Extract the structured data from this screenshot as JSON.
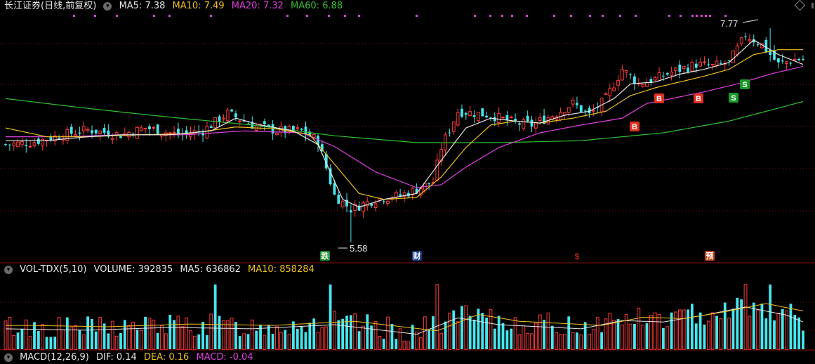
{
  "main_header": {
    "stock_label": "长江证券(日线,前复权)",
    "ma5": "MA5: 7.38",
    "ma10": "MA10: 7.49",
    "ma20": "MA20: 7.32",
    "ma60": "MA60: 6.88"
  },
  "volume_header": {
    "indicator": "VOL-TDX(5,10)",
    "volume": "VOLUME: 392835",
    "ma5": "MA5: 636862",
    "ma10": "MA10: 858284"
  },
  "macd_header": {
    "indicator": "MACD(12,26,9)",
    "dif": "DIF: 0.14",
    "dea": "DEA: 0.16",
    "macd": "MACD: -0.04"
  },
  "annotations": {
    "high_label": "7.77",
    "low_label": "5.58"
  },
  "colors": {
    "up": "#ff3a3a",
    "down": "#46e6ee",
    "ma5": "#e6e6e6",
    "ma10": "#f0c020",
    "ma20": "#e040e0",
    "ma60": "#30c030",
    "grid": "#7a1010"
  },
  "chart_data": {
    "type": "candlestick",
    "price_axis": [
      5.4,
      7.9
    ],
    "high": 7.77,
    "low": 5.58,
    "price_path": [
      [
        0,
        6.58
      ],
      [
        6,
        6.6
      ],
      [
        14,
        6.68
      ],
      [
        20,
        6.73
      ],
      [
        28,
        6.68
      ],
      [
        34,
        6.75
      ],
      [
        42,
        6.68
      ],
      [
        48,
        6.72
      ],
      [
        54,
        6.9
      ],
      [
        60,
        6.78
      ],
      [
        66,
        6.72
      ],
      [
        72,
        6.72
      ],
      [
        76,
        6.62
      ],
      [
        80,
        6.06
      ],
      [
        84,
        5.92
      ],
      [
        90,
        6.02
      ],
      [
        96,
        6.06
      ],
      [
        100,
        6.12
      ],
      [
        104,
        6.2
      ],
      [
        106,
        6.55
      ],
      [
        110,
        6.92
      ],
      [
        114,
        6.9
      ],
      [
        118,
        6.88
      ],
      [
        124,
        6.8
      ],
      [
        128,
        6.78
      ],
      [
        134,
        6.9
      ],
      [
        138,
        7.0
      ],
      [
        142,
        6.88
      ],
      [
        146,
        7.05
      ],
      [
        150,
        7.35
      ],
      [
        154,
        7.2
      ],
      [
        158,
        7.25
      ],
      [
        162,
        7.32
      ],
      [
        168,
        7.4
      ],
      [
        172,
        7.38
      ],
      [
        176,
        7.42
      ],
      [
        180,
        7.7
      ],
      [
        184,
        7.6
      ],
      [
        188,
        7.4
      ],
      [
        192,
        7.45
      ],
      [
        194,
        7.45
      ]
    ],
    "ma5_path": [
      [
        0,
        6.62
      ],
      [
        10,
        6.62
      ],
      [
        20,
        6.66
      ],
      [
        28,
        6.68
      ],
      [
        40,
        6.68
      ],
      [
        50,
        6.72
      ],
      [
        56,
        6.85
      ],
      [
        62,
        6.78
      ],
      [
        70,
        6.72
      ],
      [
        76,
        6.58
      ],
      [
        82,
        6.02
      ],
      [
        86,
        5.94
      ],
      [
        92,
        6.02
      ],
      [
        100,
        6.08
      ],
      [
        106,
        6.42
      ],
      [
        112,
        6.75
      ],
      [
        118,
        6.85
      ],
      [
        124,
        6.82
      ],
      [
        130,
        6.8
      ],
      [
        136,
        6.88
      ],
      [
        142,
        6.92
      ],
      [
        148,
        7.05
      ],
      [
        152,
        7.2
      ],
      [
        158,
        7.22
      ],
      [
        164,
        7.3
      ],
      [
        170,
        7.35
      ],
      [
        176,
        7.42
      ],
      [
        182,
        7.65
      ],
      [
        188,
        7.5
      ],
      [
        194,
        7.4
      ]
    ],
    "ma10_path": [
      [
        0,
        6.75
      ],
      [
        10,
        6.66
      ],
      [
        20,
        6.66
      ],
      [
        32,
        6.68
      ],
      [
        44,
        6.69
      ],
      [
        56,
        6.76
      ],
      [
        66,
        6.74
      ],
      [
        74,
        6.68
      ],
      [
        80,
        6.38
      ],
      [
        86,
        6.08
      ],
      [
        92,
        6.02
      ],
      [
        100,
        6.04
      ],
      [
        106,
        6.25
      ],
      [
        112,
        6.55
      ],
      [
        118,
        6.78
      ],
      [
        124,
        6.82
      ],
      [
        130,
        6.8
      ],
      [
        138,
        6.85
      ],
      [
        146,
        6.92
      ],
      [
        152,
        7.08
      ],
      [
        158,
        7.16
      ],
      [
        164,
        7.22
      ],
      [
        170,
        7.28
      ],
      [
        176,
        7.35
      ],
      [
        182,
        7.5
      ],
      [
        188,
        7.55
      ],
      [
        194,
        7.55
      ]
    ],
    "ma20_path": [
      [
        0,
        6.66
      ],
      [
        14,
        6.66
      ],
      [
        28,
        6.68
      ],
      [
        44,
        6.68
      ],
      [
        58,
        6.72
      ],
      [
        72,
        6.7
      ],
      [
        80,
        6.56
      ],
      [
        90,
        6.3
      ],
      [
        100,
        6.14
      ],
      [
        106,
        6.17
      ],
      [
        112,
        6.35
      ],
      [
        120,
        6.55
      ],
      [
        130,
        6.7
      ],
      [
        140,
        6.78
      ],
      [
        150,
        6.85
      ],
      [
        156,
        7.0
      ],
      [
        162,
        7.05
      ],
      [
        170,
        7.12
      ],
      [
        178,
        7.2
      ],
      [
        186,
        7.3
      ],
      [
        194,
        7.38
      ]
    ],
    "ma60_path": [
      [
        0,
        7.05
      ],
      [
        20,
        6.95
      ],
      [
        40,
        6.86
      ],
      [
        60,
        6.78
      ],
      [
        80,
        6.67
      ],
      [
        100,
        6.6
      ],
      [
        120,
        6.6
      ],
      [
        140,
        6.62
      ],
      [
        160,
        6.7
      ],
      [
        176,
        6.82
      ],
      [
        194,
        7.02
      ]
    ],
    "volume_axis": [
      0,
      2300000
    ],
    "volume_ma_shape": [
      [
        0,
        0.3
      ],
      [
        20,
        0.28
      ],
      [
        40,
        0.32
      ],
      [
        60,
        0.3
      ],
      [
        80,
        0.36
      ],
      [
        100,
        0.22
      ],
      [
        110,
        0.46
      ],
      [
        120,
        0.36
      ],
      [
        140,
        0.3
      ],
      [
        150,
        0.42
      ],
      [
        160,
        0.4
      ],
      [
        170,
        0.5
      ],
      [
        180,
        0.62
      ],
      [
        190,
        0.5
      ],
      [
        194,
        0.4
      ]
    ],
    "macd_series": {
      "dif": 0.14,
      "dea": 0.16,
      "macd": -0.04
    }
  },
  "event_markers": {
    "drop_label": "跌",
    "finance_label": "财",
    "dollar_label": "$",
    "forecast_label": "预",
    "buy_label": "B",
    "sell_label": "S"
  }
}
